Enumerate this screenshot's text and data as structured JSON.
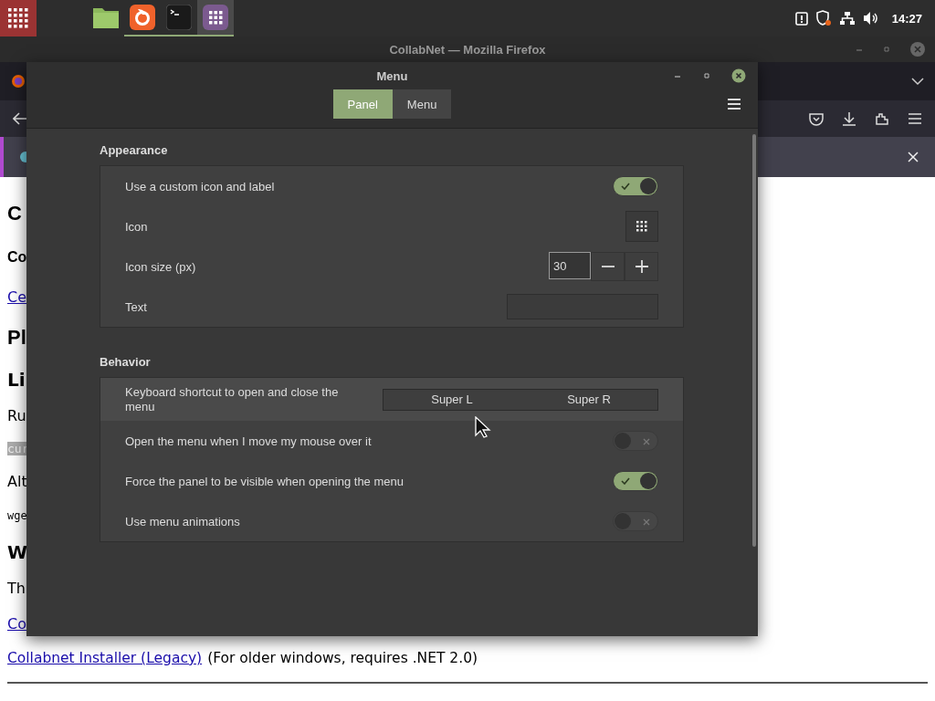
{
  "taskbar": {
    "launchers": [
      {
        "kind": "folder",
        "running": false,
        "selected": false
      },
      {
        "kind": "browser",
        "running": true,
        "selected": false
      },
      {
        "kind": "terminal",
        "running": true,
        "selected": false
      },
      {
        "kind": "grid",
        "running": true,
        "selected": true
      }
    ],
    "clock": "14:27"
  },
  "browser": {
    "title": "CollabNet — Mozilla Firefox",
    "page": [
      {
        "kind": "h1",
        "text": "C"
      },
      {
        "kind": "h2",
        "text": "Co"
      },
      {
        "kind": "link",
        "text": "Ce"
      },
      {
        "kind": "h1",
        "text": "Pl"
      },
      {
        "kind": "h3",
        "text": "Li"
      },
      {
        "kind": "p",
        "text": "Ru"
      },
      {
        "kind": "code",
        "text": "cur"
      },
      {
        "kind": "p",
        "text": "Alt"
      },
      {
        "kind": "mono",
        "text": "wge"
      },
      {
        "kind": "h3",
        "text": "W"
      },
      {
        "kind": "p",
        "text": "Th"
      },
      {
        "kind": "link",
        "text": "Co"
      }
    ],
    "installer": {
      "link": "Collabnet Installer (Legacy)",
      "note": "(For older windows, requires .NET 2.0)"
    }
  },
  "dialog": {
    "title": "Menu",
    "tabs": [
      {
        "label": "Panel",
        "selected": true
      },
      {
        "label": "Menu",
        "selected": false
      }
    ],
    "sections": [
      {
        "title": "Appearance",
        "rows": [
          {
            "kind": "switch",
            "label": "Use a custom icon and label",
            "on": true
          },
          {
            "kind": "icon",
            "label": "Icon"
          },
          {
            "kind": "spin",
            "label": "Icon size (px)",
            "value": "30"
          },
          {
            "kind": "entry",
            "label": "Text"
          }
        ]
      },
      {
        "title": "Behavior",
        "rows": [
          {
            "kind": "shortcut",
            "label": "Keyboard shortcut to open and close the menu",
            "keys": [
              "Super L",
              "Super R"
            ]
          },
          {
            "kind": "switch",
            "label": "Open the menu when I move my mouse over it",
            "on": false
          },
          {
            "kind": "switch",
            "label": "Force the panel to be visible when opening the menu",
            "on": true
          },
          {
            "kind": "switch",
            "label": "Use menu animations",
            "on": false
          }
        ]
      }
    ]
  }
}
